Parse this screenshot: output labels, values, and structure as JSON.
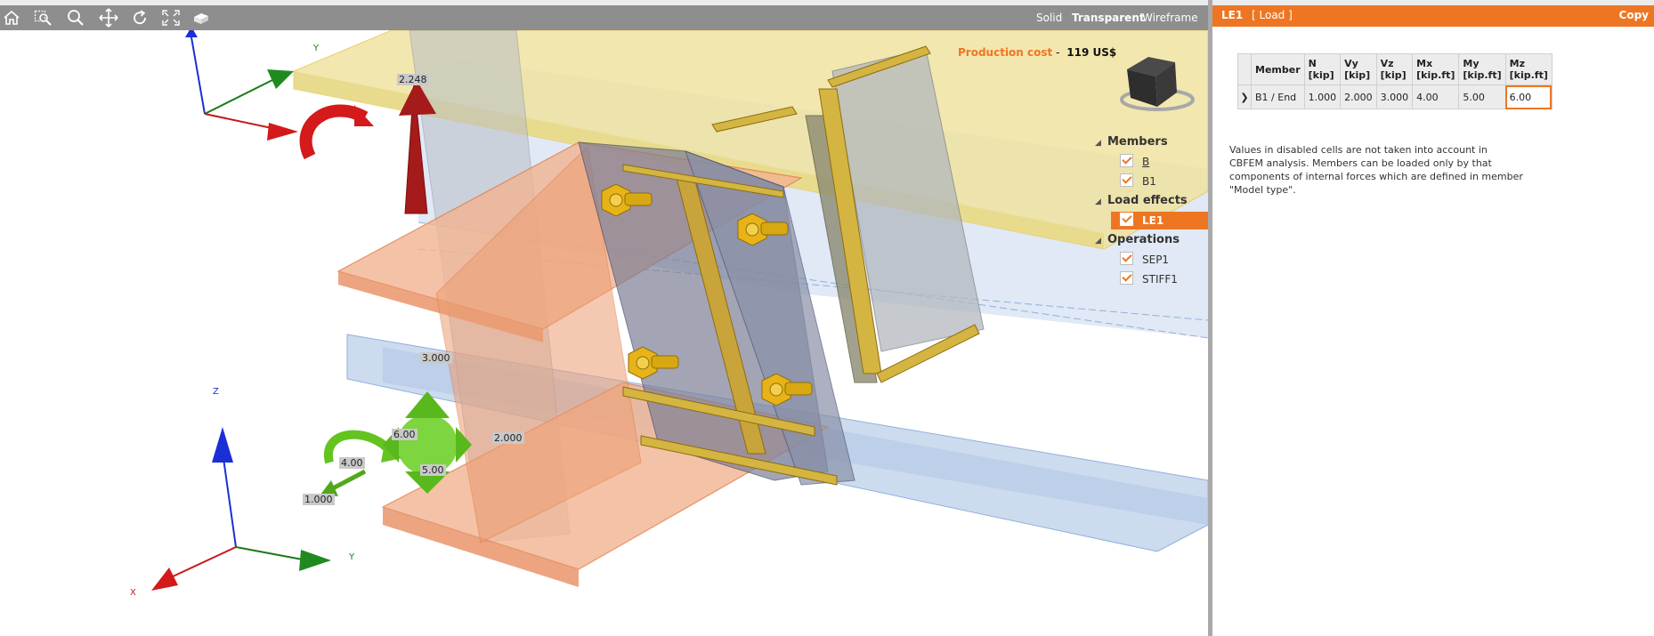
{
  "viewport": {
    "toolbar": {
      "icons": [
        "home-icon",
        "zoom-window-icon",
        "zoom-icon",
        "pan-icon",
        "rotate-icon",
        "zoom-extents-icon",
        "view-cube-icon"
      ],
      "view_modes": [
        {
          "label": "Solid",
          "active": false
        },
        {
          "label": "Transparent",
          "active": true
        },
        {
          "label": "Wireframe",
          "active": false
        }
      ]
    },
    "production_cost": {
      "label": "Production cost",
      "separator": "-",
      "value": "119 US$"
    },
    "tree": {
      "groups": [
        {
          "label": "Members",
          "items": [
            {
              "label": "B",
              "checked": true
            },
            {
              "label": "B1",
              "checked": true
            }
          ]
        },
        {
          "label": "Load effects",
          "items": [
            {
              "label": "LE1",
              "checked": true,
              "selected": true
            }
          ]
        },
        {
          "label": "Operations",
          "items": [
            {
              "label": "SEP1",
              "checked": true
            },
            {
              "label": "STIFF1",
              "checked": true
            }
          ]
        }
      ]
    },
    "load_labels": {
      "top_force": "2.248",
      "vz": "3.000",
      "vy": "2.000",
      "mz": "6.00",
      "mx": "4.00",
      "my": "5.00",
      "n": "1.000"
    },
    "axes": {
      "top": {
        "y": "Y"
      },
      "bottom": {
        "z": "Z",
        "y": "Y",
        "x": "X"
      }
    },
    "colors": {
      "accent": "#ee7623",
      "beam": "#a9c1e3",
      "flange_top": "#f2e6a3",
      "member": "#f2a87c",
      "plate": "#8a8aa0",
      "bolt": "#e8b41a",
      "moment": "#66cc22",
      "force": "#a51a1a"
    }
  },
  "panel": {
    "title": "LE1",
    "subtitle": "[ Load ]",
    "copy_label": "Copy",
    "table": {
      "headers": [
        {
          "top": "Member",
          "bottom": ""
        },
        {
          "top": "N",
          "bottom": "[kip]"
        },
        {
          "top": "Vy",
          "bottom": "[kip]"
        },
        {
          "top": "Vz",
          "bottom": "[kip]"
        },
        {
          "top": "Mx",
          "bottom": "[kip.ft]"
        },
        {
          "top": "My",
          "bottom": "[kip.ft]"
        },
        {
          "top": "Mz",
          "bottom": "[kip.ft]"
        }
      ],
      "rows": [
        {
          "expander": "❯",
          "member": "B1 / End",
          "N": "1.000",
          "Vy": "2.000",
          "Vz": "3.000",
          "Mx": "4.00",
          "My": "5.00",
          "Mz": "6.00"
        }
      ]
    },
    "note": "Values in disabled cells are not taken into account in CBFEM analysis. Members can be loaded only by that components of internal forces which are defined in member \"Model type\"."
  }
}
